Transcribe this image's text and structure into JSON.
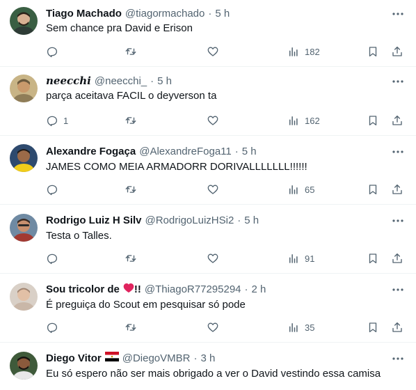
{
  "tweets": [
    {
      "name": "Tiago Machado",
      "name_badge": "",
      "handle": "@tiagormachado",
      "time": "5 h",
      "text": "Sem chance pra David e Erison",
      "reply_count": "",
      "views": "182",
      "avatar_colors": {
        "bg": "#3a5f43",
        "face": "#d8b092",
        "hair": "#2c2118",
        "shirt": "#2e3c36"
      }
    },
    {
      "name": "neecchi",
      "name_badge": "",
      "handle": "@neecchi_",
      "time": "5 h",
      "text": "parça aceitava FACIL o deyverson ta",
      "reply_count": "1",
      "views": "162",
      "avatar_colors": {
        "bg": "#c8b486",
        "face": "#c99a6c",
        "hair": "#6b5a3e",
        "shirt": "#8f7d58"
      }
    },
    {
      "name": "Alexandre Fogaça",
      "name_badge": "",
      "handle": "@AlexandreFoga11",
      "time": "5 h",
      "text": "JAMES COMO MEIA ARMADORR DORIVALLLLLLL!!!!!!",
      "reply_count": "",
      "views": "65",
      "avatar_colors": {
        "bg": "#2e4a6e",
        "face": "#9b6a48",
        "hair": "#1e1a18",
        "shirt": "#f2cd1a"
      }
    },
    {
      "name": "Rodrigo Luiz H Silv",
      "name_badge": "",
      "handle": "@RodrigoLuizHSi2",
      "time": "5 h",
      "text": "Testa o Talles.",
      "reply_count": "",
      "views": "91",
      "avatar_colors": {
        "bg": "#6f8aa3",
        "face": "#c9906e",
        "hair": "#3a2a22",
        "shirt": "#a23a32"
      }
    },
    {
      "name": "Sou tricolor de",
      "name_badge": "!!",
      "handle": "@ThiagoR77295294",
      "time": "2 h",
      "text": "É preguiça do Scout em pesquisar só pode",
      "reply_count": "",
      "views": "35",
      "avatar_colors": {
        "bg": "#d9d0c7",
        "face": "#e2c0a6",
        "hair": "#a08572",
        "shirt": "#c9b7a8"
      }
    },
    {
      "name": "Diego Vitor",
      "name_badge": "",
      "handle": "@DiegoVMBR",
      "time": "3 h",
      "text": "Eu só espero não ser mais obrigado a ver o David vestindo essa camisa",
      "reply_count": "",
      "views": "",
      "avatar_colors": {
        "bg": "#3f5a3a",
        "face": "#8a5a3c",
        "hair": "#151210",
        "shirt": "#e8e8e8"
      }
    }
  ],
  "icons": {
    "reply": "reply-icon",
    "retweet": "retweet-icon",
    "like": "heart-icon",
    "views": "views-icon",
    "bookmark": "bookmark-icon",
    "share": "share-icon",
    "more": "more-icon"
  },
  "colors": {
    "text": "#0f1419",
    "muted": "#536471",
    "divider": "#eff3f4",
    "heart": "#e0245e"
  }
}
